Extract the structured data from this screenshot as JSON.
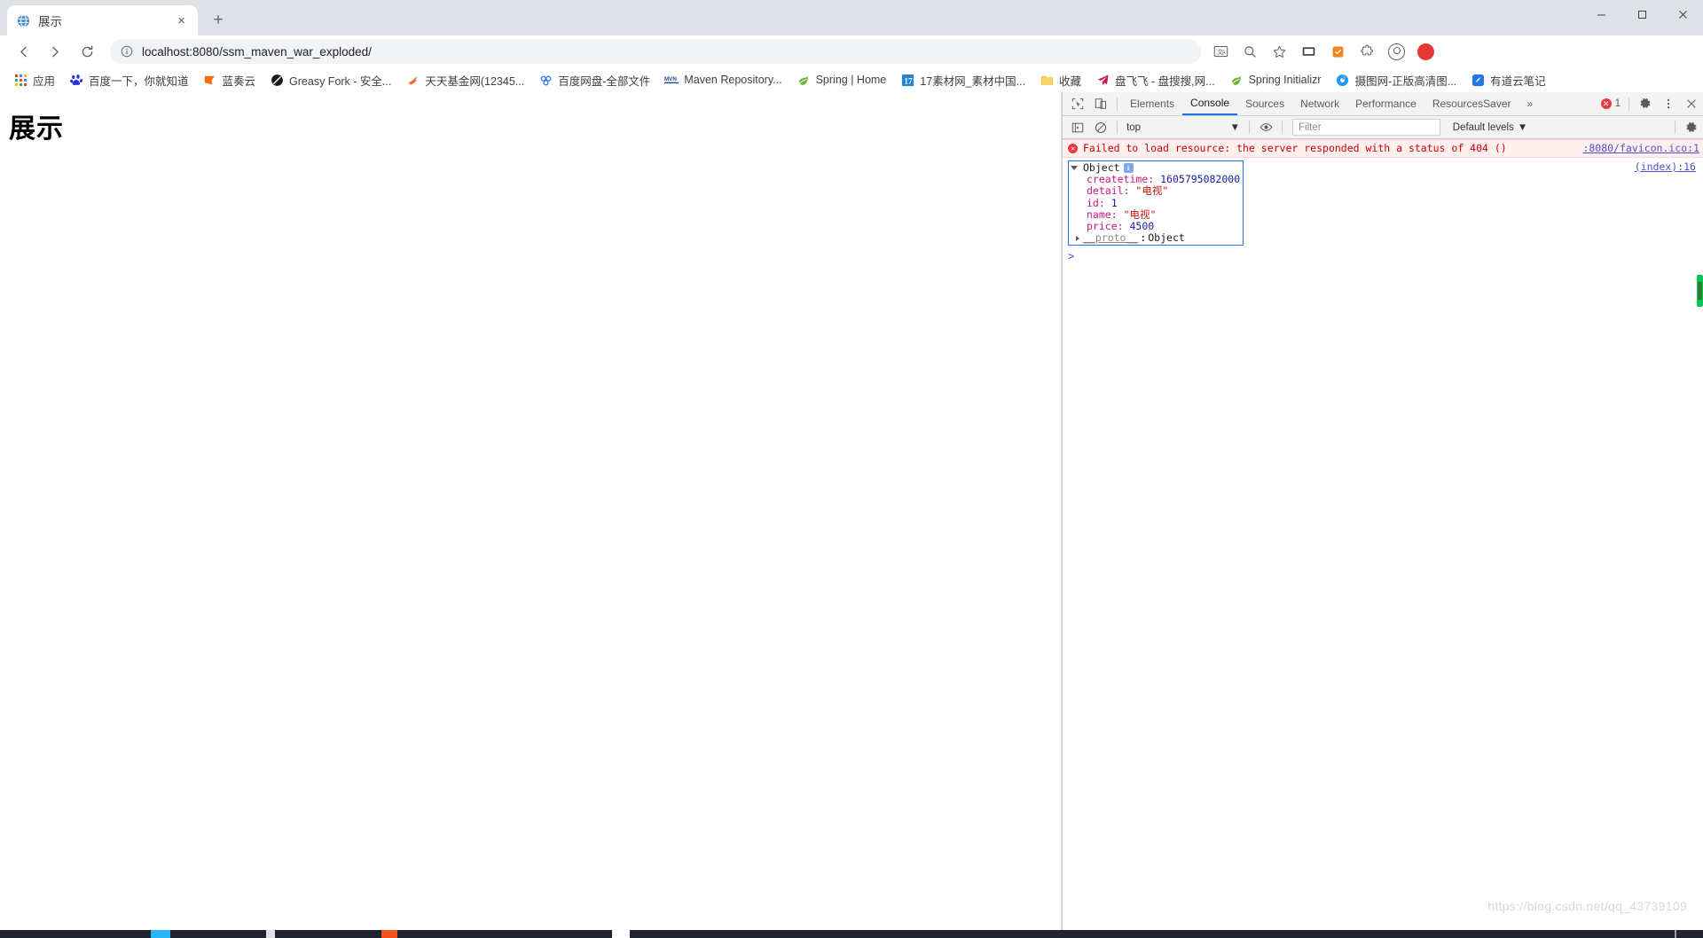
{
  "browser": {
    "tab": {
      "title": "展示",
      "favicon": "globe-icon",
      "close": "×"
    },
    "new_tab": "+",
    "window_controls": {
      "minimize": "—",
      "maximize": "▢",
      "close": "✕"
    },
    "nav": {
      "back": "←",
      "forward": "→",
      "reload": "⟳"
    },
    "omnibox": {
      "security_icon": "info-circle-icon",
      "url": "localhost:8080/ssm_maven_war_exploded/"
    },
    "toolbar_icons": [
      {
        "name": "translate-icon",
        "glyph": "文A"
      },
      {
        "name": "zoom-icon",
        "glyph": "⌕"
      },
      {
        "name": "bookmark-star-icon",
        "glyph": "☆"
      },
      {
        "name": "media-cast-icon",
        "glyph": "▭"
      },
      {
        "name": "extension-orange-icon",
        "glyph": "◼"
      },
      {
        "name": "extensions-puzzle-icon",
        "glyph": "🧩"
      },
      {
        "name": "profile-avatar-icon",
        "glyph": ""
      },
      {
        "name": "record-red-icon",
        "glyph": ""
      }
    ],
    "bookmarks": [
      {
        "label": "应用",
        "icon": "apps-grid-icon"
      },
      {
        "label": "百度一下，你就知道",
        "icon": "baidu-icon"
      },
      {
        "label": "蓝奏云",
        "icon": "lanzou-icon"
      },
      {
        "label": "Greasy Fork - 安全...",
        "icon": "greasyfork-icon"
      },
      {
        "label": "天天基金网(12345...",
        "icon": "fund-icon"
      },
      {
        "label": "百度网盘-全部文件",
        "icon": "baidupan-icon"
      },
      {
        "label": "Maven Repository...",
        "icon": "maven-icon"
      },
      {
        "label": "Spring | Home",
        "icon": "spring-leaf-icon"
      },
      {
        "label": "17素材网_素材中国...",
        "icon": "sucai17-icon"
      },
      {
        "label": "收藏",
        "icon": "folder-icon"
      },
      {
        "label": "盘飞飞 - 盘搜搜,网...",
        "icon": "plane-icon"
      },
      {
        "label": "Spring Initializr",
        "icon": "spring-leaf-icon"
      },
      {
        "label": "摄图网-正版高清图...",
        "icon": "shetu-icon"
      },
      {
        "label": "有道云笔记",
        "icon": "youdao-icon"
      }
    ]
  },
  "page": {
    "heading": "展示"
  },
  "devtools": {
    "left_icons": [
      {
        "name": "inspect-element-icon"
      },
      {
        "name": "device-toolbar-icon"
      }
    ],
    "tabs": [
      {
        "label": "Elements",
        "active": false
      },
      {
        "label": "Console",
        "active": true
      },
      {
        "label": "Sources",
        "active": false
      },
      {
        "label": "Network",
        "active": false
      },
      {
        "label": "Performance",
        "active": false
      },
      {
        "label": "ResourcesSaver",
        "active": false
      }
    ],
    "overflow": "»",
    "error_count": "1",
    "right_icons": [
      {
        "name": "settings-gear-icon",
        "glyph": "⚙"
      },
      {
        "name": "more-options-icon",
        "glyph": "⋮"
      },
      {
        "name": "close-devtools-icon",
        "glyph": "✕"
      }
    ],
    "filter_bar": {
      "sidebar_toggle": "console-sidebar-icon",
      "clear_console": "clear-console-icon",
      "context": "top",
      "context_caret": "▼",
      "eye_icon": "live-expression-eye-icon",
      "filter_placeholder": "Filter",
      "filter_value": "",
      "levels_label": "Default levels",
      "levels_caret": "▼",
      "settings_icon": "console-settings-gear-icon"
    },
    "console": {
      "error_message": {
        "badge": "✕",
        "text": "Failed to load resource: the server responded with a status of 404 ()",
        "source": ":8080/favicon.ico:1"
      },
      "object_log": {
        "source": "(index):16",
        "label": "Object",
        "info_badge": "i",
        "properties": [
          {
            "key": "createtime",
            "value": "1605795082000",
            "type": "number"
          },
          {
            "key": "detail",
            "value": "\"电视\"",
            "type": "string"
          },
          {
            "key": "id",
            "value": "1",
            "type": "number"
          },
          {
            "key": "name",
            "value": "\"电视\"",
            "type": "string"
          },
          {
            "key": "price",
            "value": "4500",
            "type": "number"
          }
        ],
        "proto": {
          "key": "__proto__",
          "value": "Object"
        }
      },
      "prompt": ">"
    }
  },
  "watermark": "https://blog.csdn.net/qq_43739109",
  "colors": {
    "accent": "#1a73e8",
    "error": "#eb3941",
    "tabstrip": "#dee1e6"
  }
}
